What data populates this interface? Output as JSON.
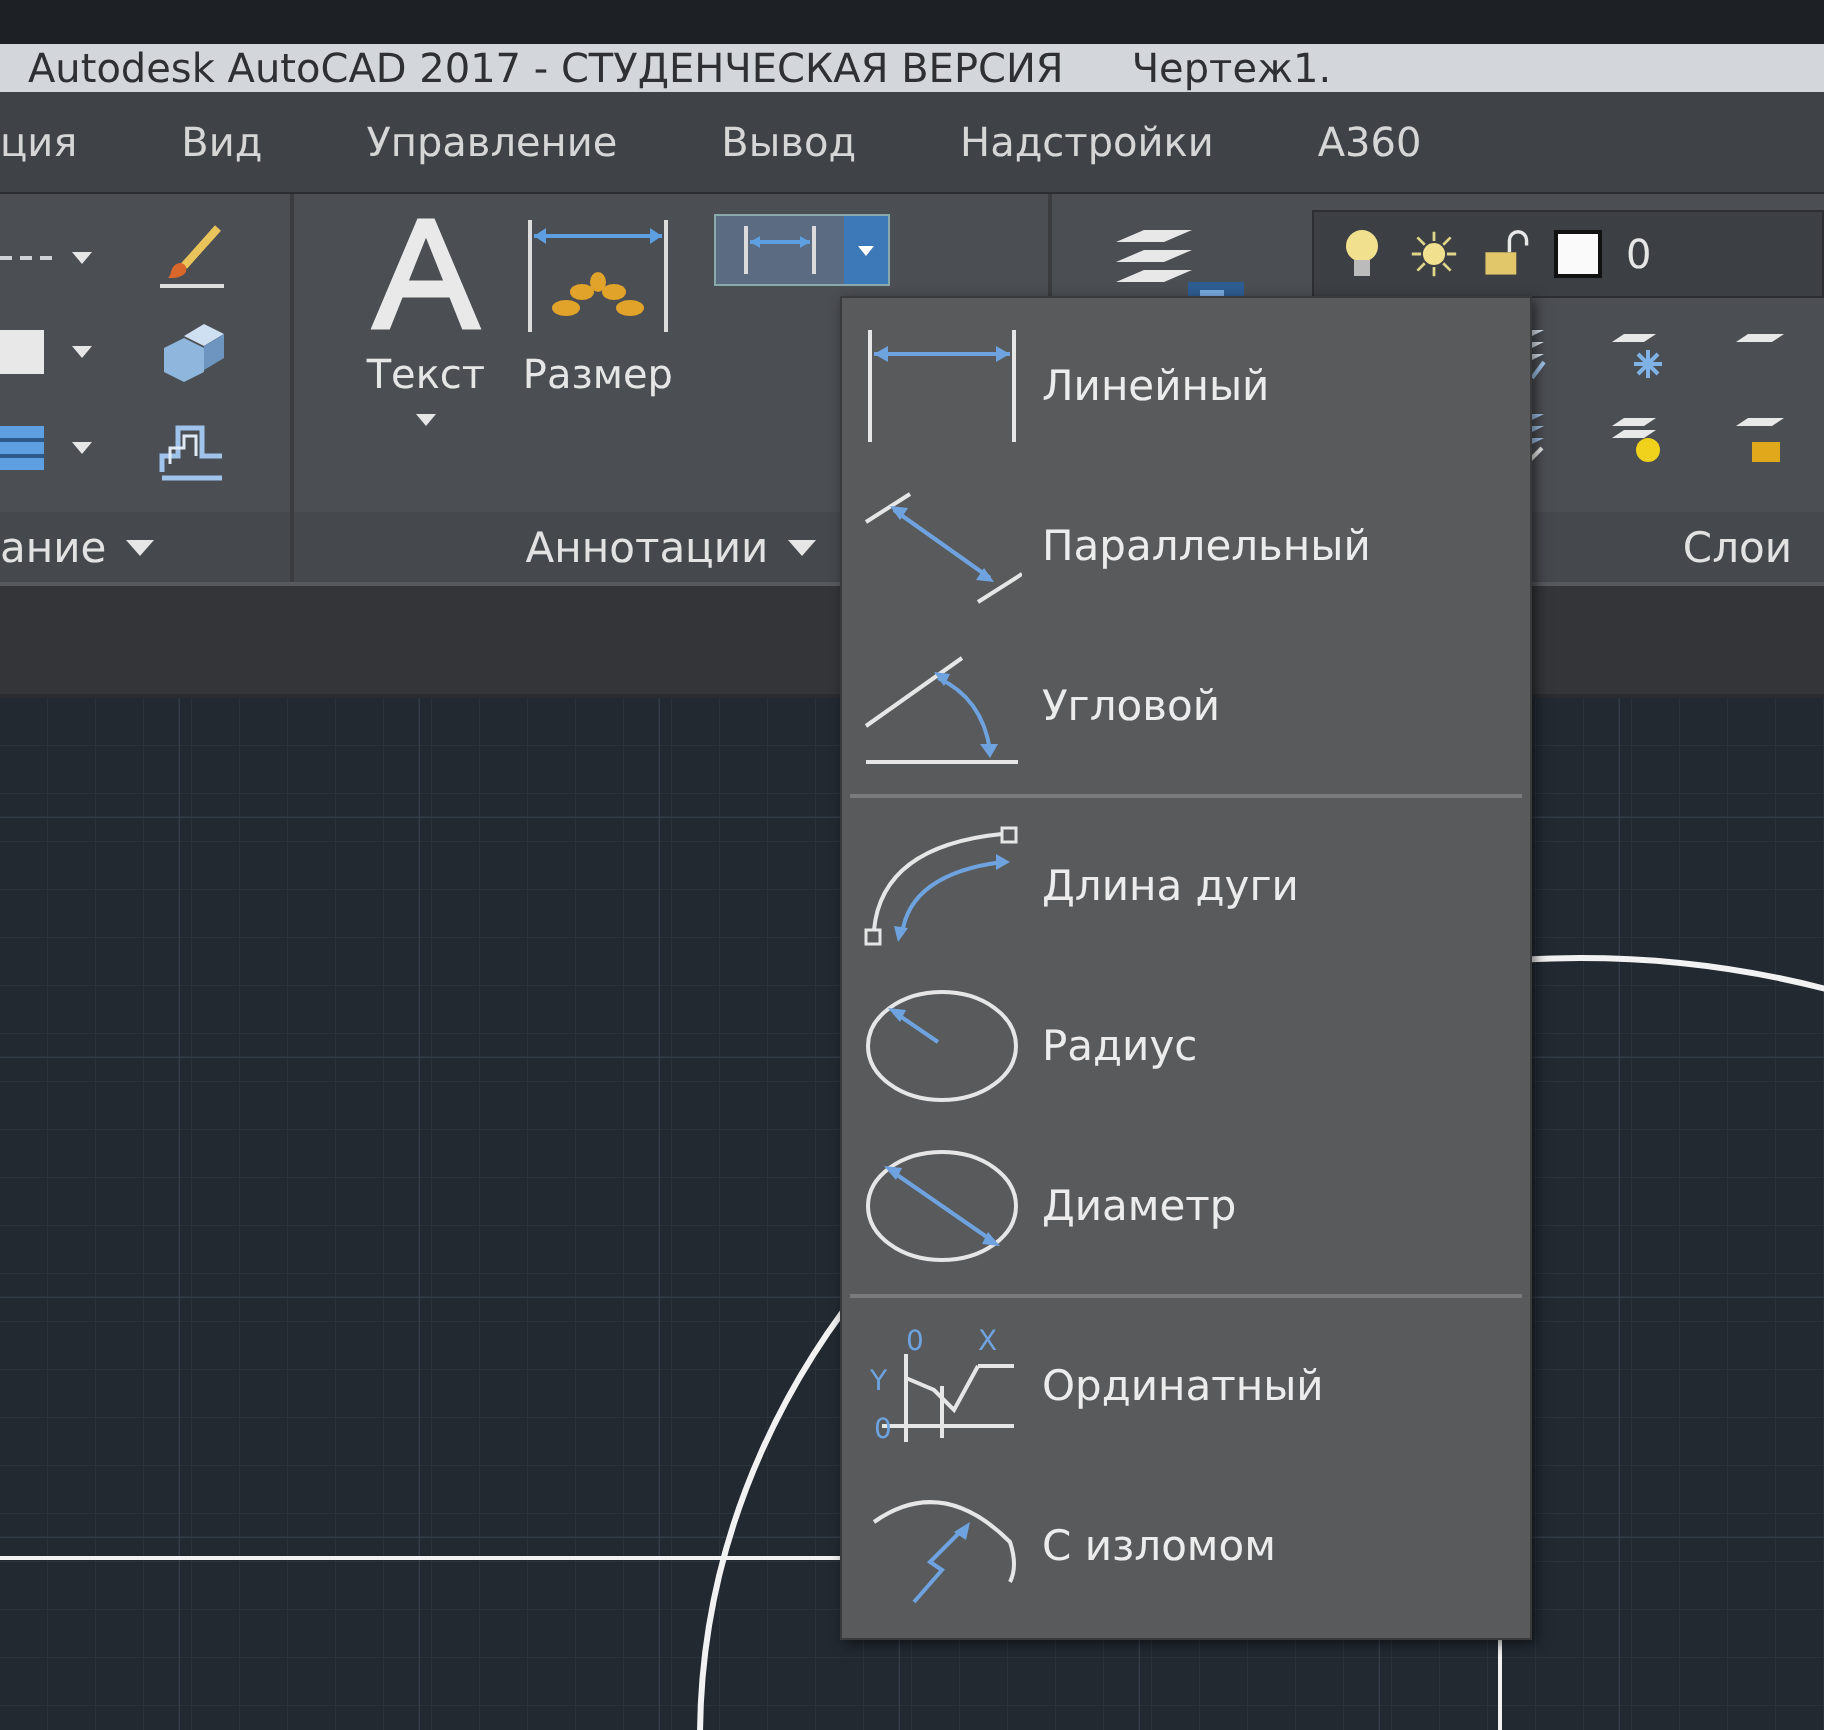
{
  "window": {
    "title": "Autodesk AutoCAD 2017 - СТУДЕНЧЕСКАЯ ВЕРСИЯ",
    "document": "Чертеж1."
  },
  "tabs": [
    {
      "label": "ция"
    },
    {
      "label": "Вид"
    },
    {
      "label": "Управление"
    },
    {
      "label": "Вывод"
    },
    {
      "label": "Надстройки"
    },
    {
      "label": "А360"
    }
  ],
  "ribbon": {
    "panels": [
      {
        "label": "ание",
        "has_menu": true
      },
      {
        "label": "Аннотации",
        "has_menu": true
      },
      {
        "label": "Слои",
        "has_menu": false
      }
    ],
    "text_tool": {
      "label": "Текст"
    },
    "dimension_tool": {
      "label": "Размер"
    },
    "layer_name": "0"
  },
  "dimension_menu": {
    "groups": [
      [
        {
          "label": "Линейный",
          "kind": "linear"
        },
        {
          "label": "Параллельный",
          "kind": "aligned"
        },
        {
          "label": "Угловой",
          "kind": "angular"
        }
      ],
      [
        {
          "label": "Длина дуги",
          "kind": "arc"
        },
        {
          "label": "Радиус",
          "kind": "radius"
        },
        {
          "label": "Диаметр",
          "kind": "diameter"
        }
      ],
      [
        {
          "label": "Ординатный",
          "kind": "ordinate",
          "icon_text": [
            "0",
            "X",
            "Y",
            "0"
          ]
        },
        {
          "label": "С изломом",
          "kind": "jogged"
        }
      ]
    ]
  }
}
